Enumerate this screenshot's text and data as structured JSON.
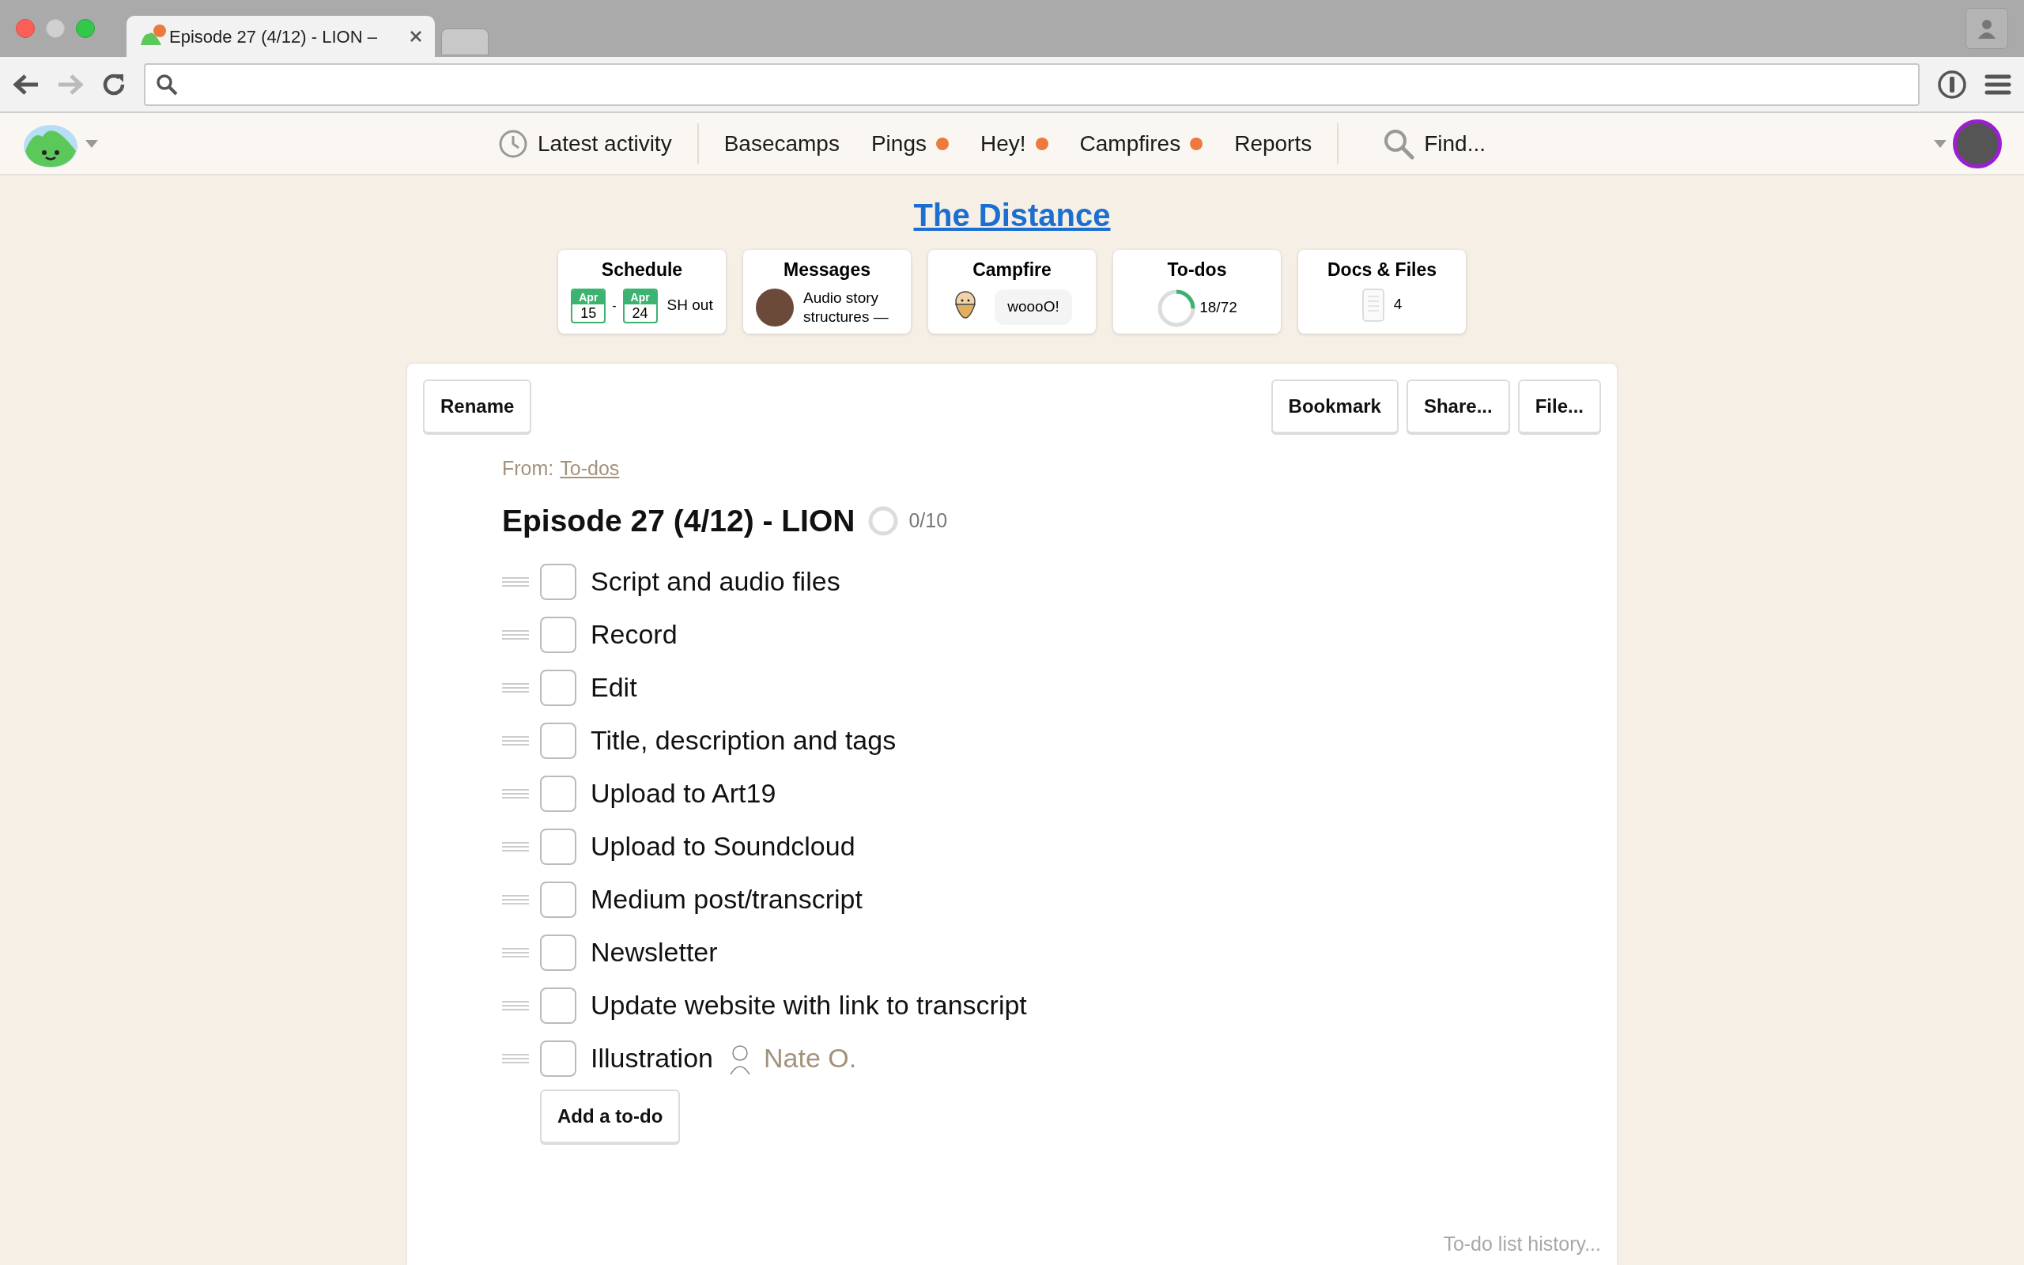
{
  "browser": {
    "tab_title": "Episode 27 (4/12) - LION –",
    "tab_unread": true
  },
  "nav": {
    "items": [
      {
        "kind": "activity",
        "label": "Latest activity"
      },
      {
        "kind": "link",
        "label": "Basecamps",
        "unread": false
      },
      {
        "kind": "link",
        "label": "Pings",
        "unread": true
      },
      {
        "kind": "link",
        "label": "Hey!",
        "unread": true
      },
      {
        "kind": "link",
        "label": "Campfires",
        "unread": true
      },
      {
        "kind": "link",
        "label": "Reports",
        "unread": false
      },
      {
        "kind": "find",
        "label": "Find..."
      }
    ]
  },
  "project": {
    "title": "The Distance"
  },
  "cards": [
    {
      "kind": "schedule",
      "title": "Schedule",
      "dates": [
        {
          "month": "Apr",
          "day": "15"
        },
        {
          "month": "Apr",
          "day": "24"
        }
      ],
      "separator": "-",
      "text": "SH out"
    },
    {
      "kind": "messages",
      "title": "Messages",
      "text": "Audio story structures —"
    },
    {
      "kind": "campfire",
      "title": "Campfire",
      "text": "woooO!"
    },
    {
      "kind": "todos",
      "title": "To-dos",
      "level": 0.25,
      "text": "18/72"
    },
    {
      "kind": "docs",
      "title": "Docs & Files",
      "text": "4"
    }
  ],
  "toolbar": {
    "left": [
      "Rename"
    ],
    "right": [
      "Bookmark",
      "Share...",
      "File..."
    ]
  },
  "list": {
    "from_label": "From:",
    "from_link": "To-dos",
    "title": "Episode 27 (4/12) - LION",
    "level": 0,
    "progress": "0/10",
    "items": [
      {
        "text": "Script and audio files",
        "checked": false
      },
      {
        "text": "Record",
        "checked": false
      },
      {
        "text": "Edit",
        "checked": false
      },
      {
        "text": "Title, description and tags",
        "checked": false
      },
      {
        "text": "Upload to Art19",
        "checked": false
      },
      {
        "text": "Upload to Soundcloud",
        "checked": false
      },
      {
        "text": "Medium post/transcript",
        "checked": false
      },
      {
        "text": "Newsletter",
        "checked": false
      },
      {
        "text": "Update website with link to transcript",
        "checked": false
      },
      {
        "text": "Illustration",
        "checked": false,
        "assignee": "Nate O."
      }
    ],
    "add_button": "Add a to-do",
    "history_link": "To-do list history..."
  }
}
